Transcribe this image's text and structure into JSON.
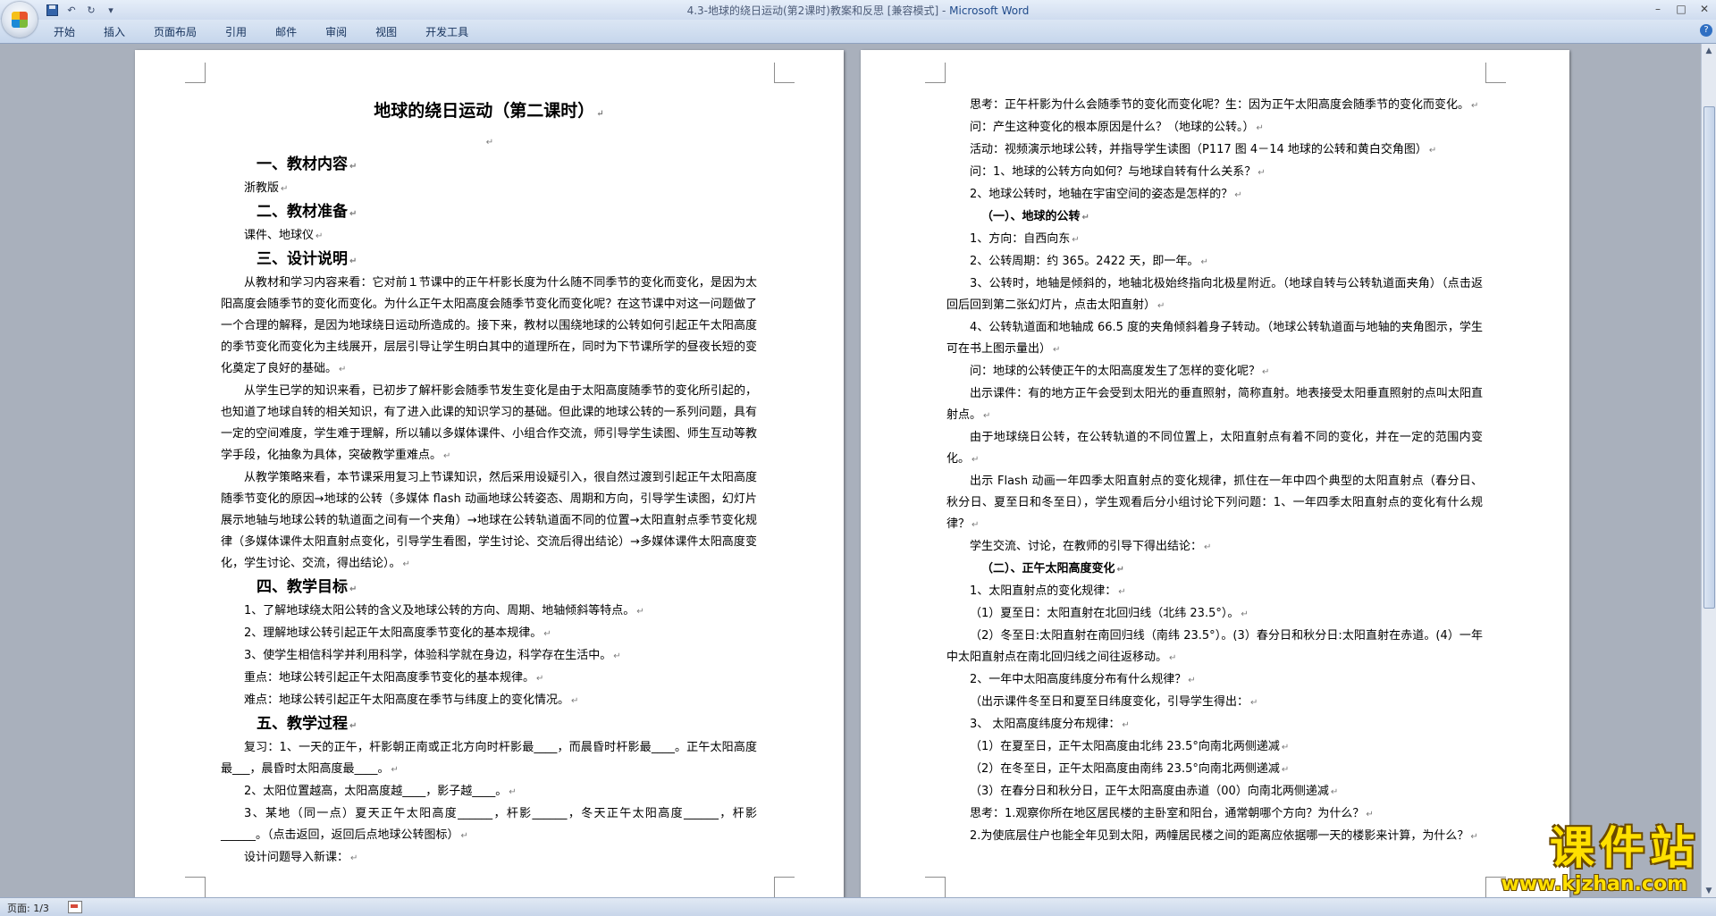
{
  "window": {
    "title": "4.3-地球的绕日运动(第2课时)教案和反思 [兼容模式] - ",
    "app_name": "Microsoft Word",
    "controls": [
      "–",
      "□",
      "✕"
    ]
  },
  "qat": {
    "save": "save",
    "undo": "↶",
    "redo": "↻",
    "customize": "▾"
  },
  "ribbon": {
    "tabs": [
      "开始",
      "插入",
      "页面布局",
      "引用",
      "邮件",
      "审阅",
      "视图",
      "开发工具"
    ],
    "help": "?"
  },
  "page_left": {
    "title": "地球的绕日运动（第二课时）",
    "h1_1": "一、教材内容",
    "p_1": "浙教版",
    "h1_2": "二、教材准备",
    "p_2": "课件、地球仪",
    "h1_3": "三、设计说明",
    "p_3": "从教材和学习内容来看：它对前１节课中的正午杆影长度为什么随不同季节的变化而变化，是因为太阳高度会随季节的变化而变化。为什么正午太阳高度会随季节变化而变化呢？在这节课中对这一问题做了一个合理的解释，是因为地球绕日运动所造成的。接下来，教材以围绕地球的公转如何引起正午太阳高度的季节变化而变化为主线展开，层层引导让学生明白其中的道理所在，同时为下节课所学的昼夜长短的变化奠定了良好的基础。",
    "p_4": "从学生已学的知识来看，已初步了解杆影会随季节发生变化是由于太阳高度随季节的变化所引起的，也知道了地球自转的相关知识，有了进入此课的知识学习的基础。但此课的地球公转的一系列问题，具有一定的空间难度，学生难于理解，所以辅以多媒体课件、小组合作交流，师引导学生读图、师生互动等教学手段，化抽象为具体，突破教学重难点。",
    "p_5": "从教学策略来看，本节课采用复习上节课知识，然后采用设疑引入，很自然过渡到引起正午太阳高度随季节变化的原因→地球的公转（多媒体 flash 动画地球公转姿态、周期和方向，引导学生读图，幻灯片展示地轴与地球公转的轨道面之间有一个夹角）→地球在公转轨道面不同的位置→太阳直射点季节变化规律（多媒体课件太阳直射点变化，引导学生看图，学生讨论、交流后得出结论）→多媒体课件太阳高度变化，学生讨论、交流，得出结论）。",
    "h1_4": "四、教学目标",
    "p_6": "1、了解地球绕太阳公转的含义及地球公转的方向、周期、地轴倾斜等特点。",
    "p_7": "2、理解地球公转引起正午太阳高度季节变化的基本规律。",
    "p_8": "3、使学生相信科学并利用科学，体验科学就在身边，科学存在生活中。",
    "p_9": "重点：地球公转引起正午太阳高度季节变化的基本规律。",
    "p_10": "难点：地球公转引起正午太阳高度在季节与纬度上的变化情况。",
    "h1_5": "五、教学过程",
    "p_11": "复习：1、一天的正午，杆影朝正南或正北方向时杆影最____，而晨昏时杆影最____。正午太阳高度最___，晨昏时太阳高度最____。",
    "p_12": "2、太阳位置越高，太阳高度越____，影子越____。",
    "p_13": "3、某地（同一点）夏天正午太阳高度______，杆影______，冬天正午太阳高度______，杆影______。（点击返回，返回后点地球公转图标）",
    "p_14": "设计问题导入新课："
  },
  "page_right": {
    "p_1": "思考：正午杆影为什么会随季节的变化而变化呢？生：因为正午太阳高度会随季节的变化而变化。",
    "p_2": "问：产生这种变化的根本原因是什么？（地球的公转。）",
    "p_3": "活动：视频演示地球公转，并指导学生读图（P117 图 4－14 地球的公转和黄白交角图）",
    "p_4": "问：1、地球的公转方向如何？与地球自转有什么关系？",
    "p_5": "2、地球公转时，地轴在宇宙空间的姿态是怎样的？",
    "h2_1": "（一）、地球的公转",
    "p_6": "1、方向：自西向东",
    "p_7": "2、公转周期：约 365。2422 天，即一年。",
    "p_8": "3、公转时，地轴是倾斜的，地轴北极始终指向北极星附近。（地球自转与公转轨道面夹角）（点击返回后回到第二张幻灯片，点击太阳直射）",
    "p_9": "4、公转轨道面和地轴成 66.5 度的夹角倾斜着身子转动。（地球公转轨道面与地轴的夹角图示，学生可在书上图示量出）",
    "p_10": "问：地球的公转使正午的太阳高度发生了怎样的变化呢？",
    "p_11": "出示课件：有的地方正午会受到太阳光的垂直照射，简称直射。地表接受太阳垂直照射的点叫太阳直射点。",
    "p_12": "由于地球绕日公转，在公转轨道的不同位置上，太阳直射点有着不同的变化，并在一定的范围内变化。",
    "p_13": "出示 Flash 动画一年四季太阳直射点的变化规律，抓住在一年中四个典型的太阳直射点（春分日、秋分日、夏至日和冬至日），学生观看后分小组讨论下列问题：1、一年四季太阳直射点的变化有什么规律？",
    "p_14": "学生交流、讨论，在教师的引导下得出结论：",
    "h2_2": "（二）、正午太阳高度变化",
    "p_15": "1、太阳直射点的变化规律：",
    "p_16": "（1）夏至日：太阳直射在北回归线（北纬 23.5°）。",
    "p_17": "（2）冬至日:太阳直射在南回归线（南纬 23.5°）。(3）春分日和秋分日:太阳直射在赤道。(4）一年中太阳直射点在南北回归线之间往返移动。",
    "p_18": "2、一年中太阳高度纬度分布有什么规律？",
    "p_19": "（出示课件冬至日和夏至日纬度变化，引导学生得出：",
    "p_20": "3、 太阳高度纬度分布规律：",
    "p_21": "（1）在夏至日，正午太阳高度由北纬 23.5°向南北两侧递减",
    "p_22": "（2）在冬至日，正午太阳高度由南纬 23.5°向南北两侧递减",
    "p_23": "（3）在春分日和秋分日，正午太阳高度由赤道（00）向南北两侧递减",
    "p_24": "思考：1.观察你所在地区居民楼的主卧室和阳台，通常朝哪个方向？为什么？",
    "p_25": "2.为使底层住户也能全年见到太阳，两幢居民楼之间的距离应依据哪一天的楼影来计算，为什么？"
  },
  "statusbar": {
    "page": "页面: 1/3"
  },
  "watermark": {
    "main": "课件站",
    "url": "www.kjzhan.com"
  },
  "scrollbar": {
    "up": "▲",
    "down": "▼"
  }
}
